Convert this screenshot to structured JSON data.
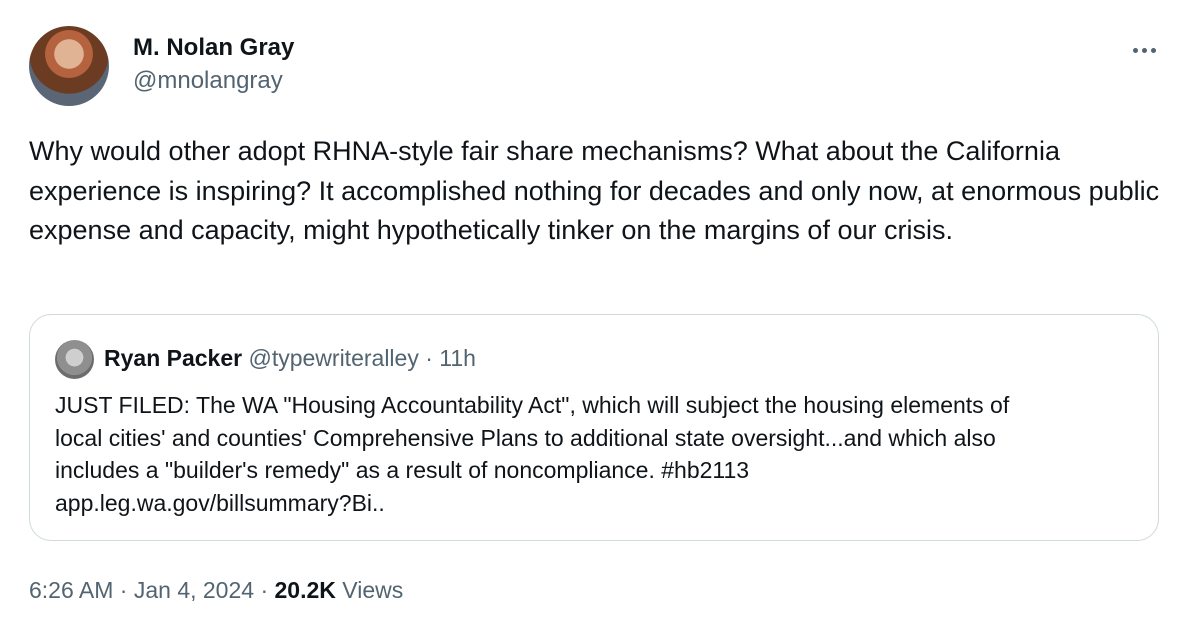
{
  "tweet": {
    "author_name": "M. Nolan Gray",
    "author_handle": "@mnolangray",
    "more_icon": "more-horizontal-icon",
    "text": "Why would other adopt RHNA-style fair share mechanisms? What about the California experience is inspiring? It accomplished nothing for decades and only now, at enormous public expense and capacity, might hypothetically tinker on the margins of our crisis.",
    "time": "6:26 AM",
    "date": "Jan 4, 2024",
    "sep": "·",
    "views_count": "20.2K",
    "views_label": "Views"
  },
  "quote": {
    "author_name": "Ryan Packer",
    "author_handle": "@typewriteralley",
    "sep": "·",
    "time": "11h",
    "lines": [
      "JUST FILED: The WA \"Housing Accountability Act\", which will subject the housing elements of",
      "local cities' and counties' Comprehensive Plans to additional state oversight...and which also",
      "includes a \"builder's remedy\" as a result of noncompliance. #hb2113",
      "app.leg.wa.gov/billsummary?Bi.."
    ]
  }
}
